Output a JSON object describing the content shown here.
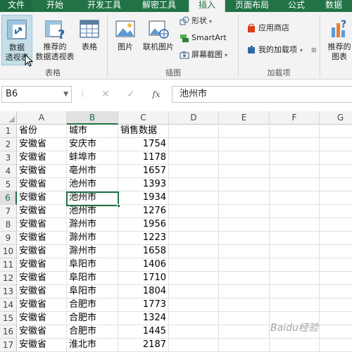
{
  "ribbon_tabs": [
    {
      "label": "文件"
    },
    {
      "label": "开始"
    },
    {
      "label": "开发工具"
    },
    {
      "label": "解密工具"
    },
    {
      "label": "插入"
    },
    {
      "label": "页面布局"
    },
    {
      "label": "公式"
    },
    {
      "label": "数据"
    }
  ],
  "active_tab": "插入",
  "ribbon": {
    "tables_group": {
      "label": "表格",
      "pivot_table_line1": "数据",
      "pivot_table_line2": "透视表",
      "recommended_pivot_line1": "推荐的",
      "recommended_pivot_line2": "数据透视表",
      "table": "表格"
    },
    "illustrations_group": {
      "label": "插图",
      "pictures": "图片",
      "online_pictures": "联机图片",
      "shapes": "形状",
      "smartart": "SmartArt",
      "screenshot": "屏幕截图"
    },
    "addins_group": {
      "label": "加载项",
      "store": "应用商店",
      "my_addins": "我的加载项"
    },
    "charts_group": {
      "recommended_charts_line1": "推荐的",
      "recommended_charts_line2": "图表"
    }
  },
  "formula_bar": {
    "name_box": "B6",
    "fx": "fx",
    "value": "池州市"
  },
  "columns": [
    "A",
    "B",
    "C",
    "D",
    "E",
    "F",
    "G"
  ],
  "active_column": "B",
  "active_row": "6",
  "rows": [
    {
      "num": "1",
      "a": "省份",
      "b": "城市",
      "c": "销售数据"
    },
    {
      "num": "2",
      "a": "安徽省",
      "b": "安庆市",
      "c": "1754"
    },
    {
      "num": "3",
      "a": "安徽省",
      "b": "蚌埠市",
      "c": "1178"
    },
    {
      "num": "4",
      "a": "安徽省",
      "b": "亳州市",
      "c": "1657"
    },
    {
      "num": "5",
      "a": "安徽省",
      "b": "池州市",
      "c": "1393"
    },
    {
      "num": "6",
      "a": "安徽省",
      "b": "池州市",
      "c": "1934"
    },
    {
      "num": "7",
      "a": "安徽省",
      "b": "池州市",
      "c": "1276"
    },
    {
      "num": "8",
      "a": "安徽省",
      "b": "滁州市",
      "c": "1956"
    },
    {
      "num": "9",
      "a": "安徽省",
      "b": "滁州市",
      "c": "1223"
    },
    {
      "num": "10",
      "a": "安徽省",
      "b": "滁州市",
      "c": "1658"
    },
    {
      "num": "11",
      "a": "安徽省",
      "b": "阜阳市",
      "c": "1406"
    },
    {
      "num": "12",
      "a": "安徽省",
      "b": "阜阳市",
      "c": "1710"
    },
    {
      "num": "13",
      "a": "安徽省",
      "b": "阜阳市",
      "c": "1804"
    },
    {
      "num": "14",
      "a": "安徽省",
      "b": "合肥市",
      "c": "1773"
    },
    {
      "num": "15",
      "a": "安徽省",
      "b": "合肥市",
      "c": "1324"
    },
    {
      "num": "16",
      "a": "安徽省",
      "b": "合肥市",
      "c": "1445"
    },
    {
      "num": "17",
      "a": "安徽省",
      "b": "淮北市",
      "c": "2187"
    }
  ],
  "watermark": "Baidu经验",
  "colors": {
    "accent": "#217346",
    "selection": "#217346"
  }
}
